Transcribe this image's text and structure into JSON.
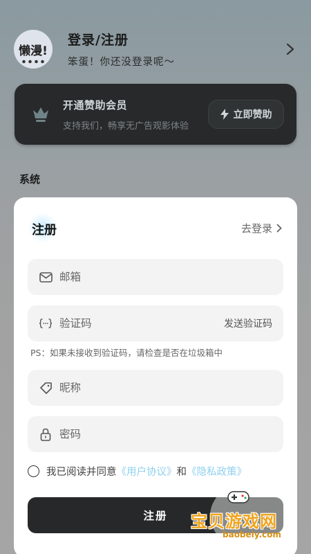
{
  "profile": {
    "avatar_text": "懒漫!",
    "title": "登录/注册",
    "subtitle": "笨蛋！你还没登录呢～"
  },
  "vip": {
    "title": "开通赞助会员",
    "subtitle": "支持我们，畅享无广告观影体验",
    "button_label": "立即赞助"
  },
  "section_title": "系统",
  "register_sheet": {
    "title": "注册",
    "to_login": "去登录",
    "email_placeholder": "邮箱",
    "code_placeholder": "验证码",
    "send_code": "发送验证码",
    "ps_note": "PS：如果未接收到验证码，请检查是否在垃圾箱中",
    "nickname_placeholder": "昵称",
    "password_placeholder": "密码",
    "agree_prefix": "我已阅读并同意",
    "user_agreement": "《用户协议》",
    "and": "和",
    "privacy_policy": "《隐私政策》",
    "submit_label": "注册"
  },
  "watermark": {
    "text": "宝贝游戏网",
    "url": "baobeiy.com"
  },
  "colors": {
    "link": "#8fd0ef",
    "dark_button": "#262829",
    "watermark": "#f0a51d"
  }
}
